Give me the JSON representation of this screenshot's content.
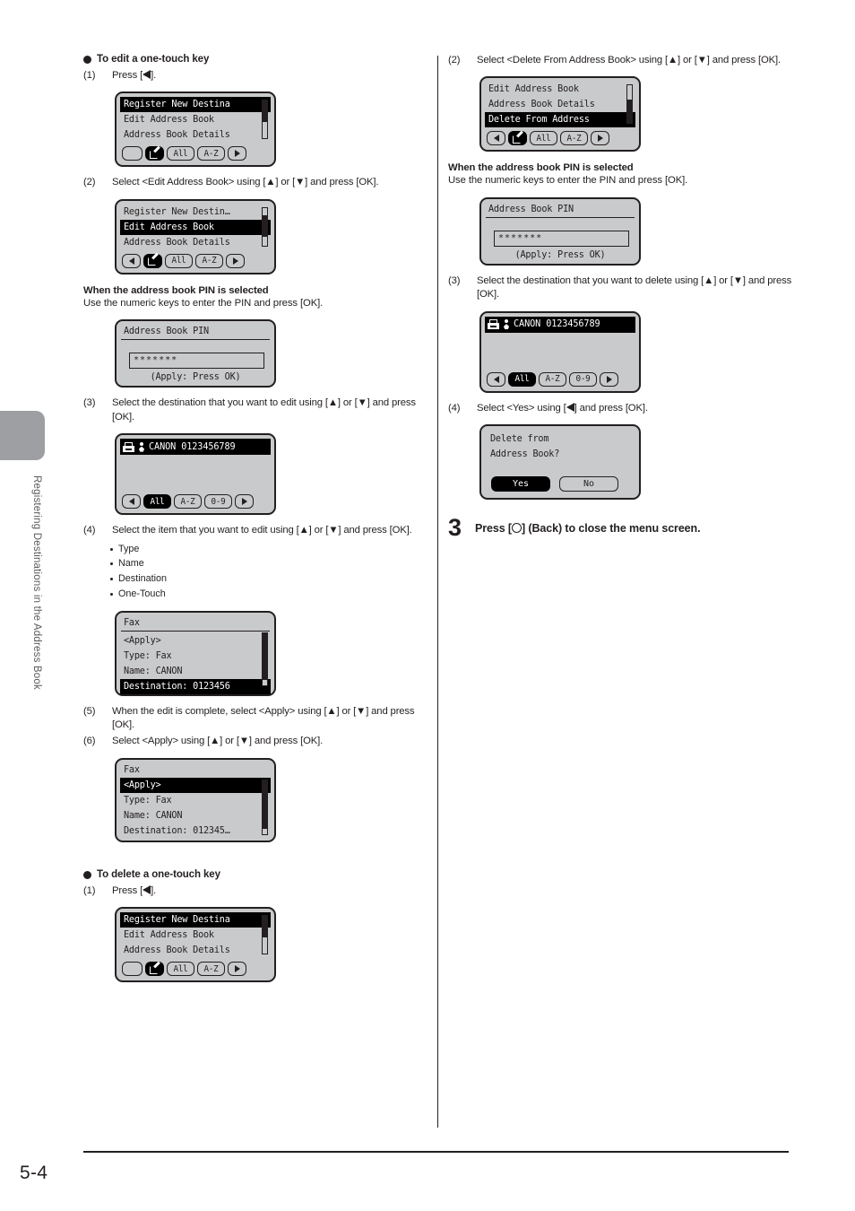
{
  "page": {
    "number": "5-4",
    "side_tab_label": "Registering Destinations in the Address Book"
  },
  "left_column": {
    "edit_section": {
      "heading": "To edit a one-touch key",
      "step1": {
        "num": "(1)",
        "text_before": "Press [",
        "text_after": "]."
      },
      "screen1": {
        "lines": [
          "Register New Destina",
          "Edit Address Book",
          "Address Book Details"
        ],
        "selected_index": 0,
        "buttons": [
          "",
          "edit-icon",
          "All",
          "A-Z",
          "right-arrow"
        ],
        "active_button_index": 1
      },
      "step2": {
        "num": "(2)",
        "text": "Select <Edit Address Book> using [▲] or [▼] and press [OK]."
      },
      "screen2": {
        "lines": [
          "Register New Destin…",
          "Edit Address Book",
          "Address Book Details"
        ],
        "selected_index": 1,
        "buttons": [
          "left-arrow",
          "edit-icon",
          "All",
          "A-Z",
          "right-arrow"
        ],
        "active_button_index": 1
      },
      "pin_heading": "When the address book PIN is selected",
      "pin_text": "Use the numeric keys to enter the PIN and press [OK].",
      "pin_screen": {
        "title": "Address Book PIN",
        "value": "*******",
        "hint": "(Apply: Press OK)"
      },
      "step3": {
        "num": "(3)",
        "text": "Select the destination that you want to edit using [▲] or [▼] and press [OK]."
      },
      "screen3": {
        "destination": "CANON 0123456789",
        "buttons": [
          "left-arrow",
          "All",
          "A-Z",
          "0-9",
          "right-arrow"
        ],
        "active_button_index": 1
      },
      "step4": {
        "num": "(4)",
        "text": "Select the item that you want to edit using [▲] or [▼] and press [OK]."
      },
      "step4_items": [
        "Type",
        "Name",
        "Destination",
        "One-Touch"
      ],
      "screen4": {
        "title": "Fax",
        "lines": [
          "<Apply>",
          "Type: Fax",
          "Name: CANON",
          "Destination: 0123456"
        ],
        "selected_index": 3
      },
      "step5": {
        "num": "(5)",
        "text": "When the edit is complete, select <Apply> using [▲] or [▼] and press [OK]."
      },
      "step6": {
        "num": "(6)",
        "text": "Select <Apply> using [▲] or [▼] and press [OK]."
      },
      "screen5": {
        "title": "Fax",
        "lines": [
          "<Apply>",
          "Type: Fax",
          "Name: CANON",
          "Destination: 012345…"
        ],
        "selected_index": 0
      }
    },
    "delete_section": {
      "heading": "To delete a one-touch key",
      "step1": {
        "num": "(1)",
        "text_before": "Press [",
        "text_after": "]."
      },
      "screen1": {
        "lines": [
          "Register New Destina",
          "Edit Address Book",
          "Address Book Details"
        ],
        "selected_index": 0,
        "buttons": [
          "",
          "edit-icon",
          "All",
          "A-Z",
          "right-arrow"
        ],
        "active_button_index": 1
      }
    }
  },
  "right_column": {
    "step2": {
      "num": "(2)",
      "text": "Select <Delete From Address Book> using [▲] or [▼] and press [OK]."
    },
    "screen1": {
      "lines": [
        "Edit Address Book",
        "Address Book Details",
        "Delete From Address"
      ],
      "selected_index": 2,
      "buttons": [
        "left-arrow",
        "edit-icon",
        "All",
        "A-Z",
        "right-arrow"
      ],
      "active_button_index": 1
    },
    "pin_heading": "When the address book PIN is selected",
    "pin_text": "Use the numeric keys to enter the PIN and press [OK].",
    "pin_screen": {
      "title": "Address Book PIN",
      "value": "*******",
      "hint": "(Apply: Press OK)"
    },
    "step3": {
      "num": "(3)",
      "text": "Select the destination that you want to delete using [▲] or [▼] and press [OK]."
    },
    "screen2": {
      "destination": "CANON 0123456789",
      "buttons": [
        "left-arrow",
        "All",
        "A-Z",
        "0-9",
        "right-arrow"
      ],
      "active_button_index": 1
    },
    "step4": {
      "num": "(4)",
      "text_before": "Select <Yes> using [",
      "text_after": "] and press [OK]."
    },
    "confirm_screen": {
      "line1": "Delete from",
      "line2": "Address Book?",
      "yes_label": "Yes",
      "no_label": "No",
      "selected": "Yes"
    },
    "big_step": {
      "num": "3",
      "text_before": "Press [",
      "text_after": "] (Back) to close the menu screen."
    }
  }
}
